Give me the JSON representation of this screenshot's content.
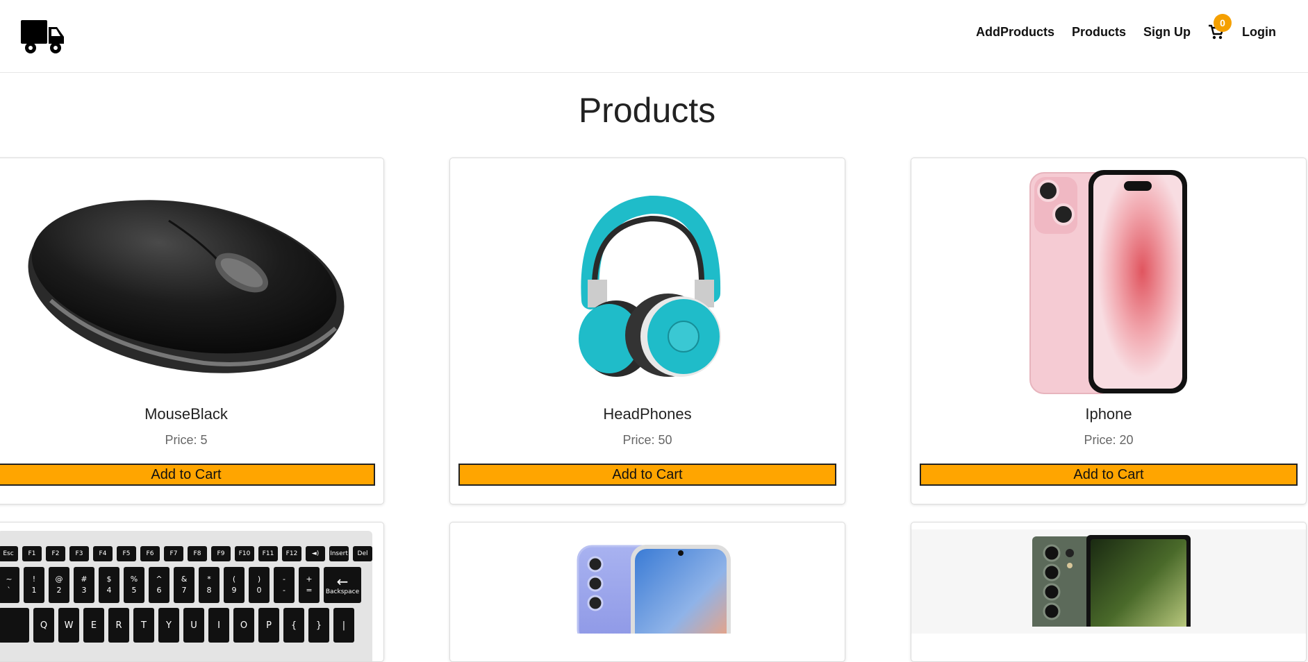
{
  "nav": {
    "links": [
      "AddProducts",
      "Products",
      "Sign Up"
    ],
    "cart_count": "0",
    "login": "Login"
  },
  "page": {
    "title": "Products"
  },
  "products": [
    {
      "name": "MouseBlack",
      "price": "Price: 5",
      "button": "Add to Cart",
      "image": "black-mouse"
    },
    {
      "name": "HeadPhones",
      "price": "Price: 50",
      "button": "Add to Cart",
      "image": "teal-headphones"
    },
    {
      "name": "Iphone",
      "price": "Price: 20",
      "button": "Add to Cart",
      "image": "pink-iphone"
    },
    {
      "image": "keyboard"
    },
    {
      "image": "blue-phone"
    },
    {
      "image": "green-phone"
    }
  ],
  "keyboard": {
    "fn_row": [
      "Esc",
      "F1",
      "F2",
      "F3",
      "F4",
      "F5",
      "F6",
      "F7",
      "F8",
      "F9",
      "F10",
      "F11",
      "F12",
      "◄)",
      "Insert",
      "Del"
    ],
    "num_row": [
      [
        "~",
        "`"
      ],
      [
        "!",
        "1"
      ],
      [
        "@",
        "2"
      ],
      [
        "#",
        "3"
      ],
      [
        "$",
        "4"
      ],
      [
        "%",
        "5"
      ],
      [
        "^",
        "6"
      ],
      [
        "&",
        "7"
      ],
      [
        "*",
        "8"
      ],
      [
        "(",
        "9"
      ],
      [
        ")",
        "0"
      ],
      [
        "-",
        "-"
      ],
      [
        "+",
        "="
      ]
    ],
    "backspace": "Backspace",
    "q_row": [
      "Q",
      "W",
      "E",
      "R",
      "T",
      "Y",
      "U",
      "I",
      "O",
      "P",
      "{",
      "}",
      "|"
    ]
  },
  "colors": {
    "accent": "#ffa500",
    "badge": "#f5a000"
  }
}
